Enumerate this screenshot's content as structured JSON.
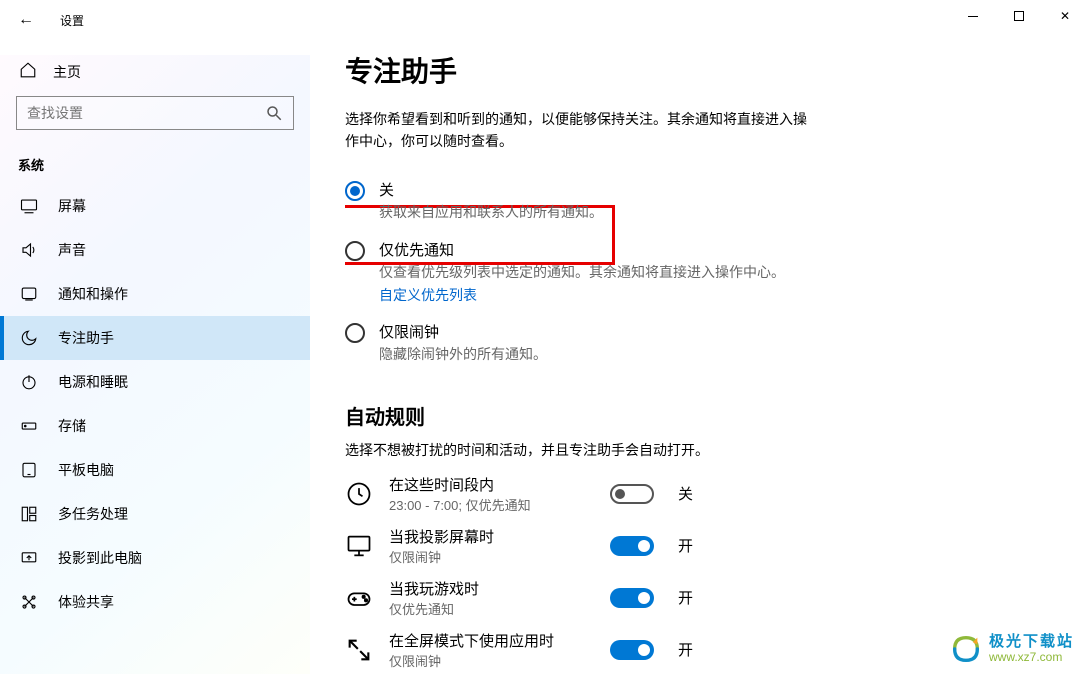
{
  "window": {
    "title": "设置"
  },
  "home_label": "主页",
  "search_placeholder": "查找设置",
  "category": "系统",
  "nav": [
    {
      "label": "屏幕",
      "icon": "display"
    },
    {
      "label": "声音",
      "icon": "sound"
    },
    {
      "label": "通知和操作",
      "icon": "notif"
    },
    {
      "label": "专注助手",
      "icon": "moon",
      "active": true
    },
    {
      "label": "电源和睡眠",
      "icon": "power"
    },
    {
      "label": "存储",
      "icon": "storage"
    },
    {
      "label": "平板电脑",
      "icon": "tablet"
    },
    {
      "label": "多任务处理",
      "icon": "multi"
    },
    {
      "label": "投影到此电脑",
      "icon": "project"
    },
    {
      "label": "体验共享",
      "icon": "share"
    }
  ],
  "page": {
    "title": "专注助手",
    "lead": "选择你希望看到和听到的通知，以便能够保持关注。其余通知将直接进入操作中心，你可以随时查看。",
    "options": [
      {
        "label": "关",
        "desc": "获取来自应用和联系人的所有通知。",
        "selected": true
      },
      {
        "label": "仅优先通知",
        "desc": "仅查看优先级列表中选定的通知。其余通知将直接进入操作中心。",
        "link": "自定义优先列表"
      },
      {
        "label": "仅限闹钟",
        "desc": "隐藏除闹钟外的所有通知。"
      }
    ],
    "auto_title": "自动规则",
    "auto_sub": "选择不想被打扰的时间和活动，并且专注助手会自动打开。",
    "states": {
      "on": "开",
      "off": "关"
    },
    "rules": [
      {
        "title": "在这些时间段内",
        "sub": "23:00 - 7:00; 仅优先通知",
        "on": false,
        "icon": "clock"
      },
      {
        "title": "当我投影屏幕时",
        "sub": "仅限闹钟",
        "on": true,
        "icon": "screen"
      },
      {
        "title": "当我玩游戏时",
        "sub": "仅优先通知",
        "on": true,
        "icon": "game"
      },
      {
        "title": "在全屏模式下使用应用时",
        "sub": "仅限闹钟",
        "on": true,
        "icon": "fullscreen"
      }
    ]
  },
  "watermark": {
    "brand": "极光下载站",
    "url": "www.xz7.com"
  }
}
